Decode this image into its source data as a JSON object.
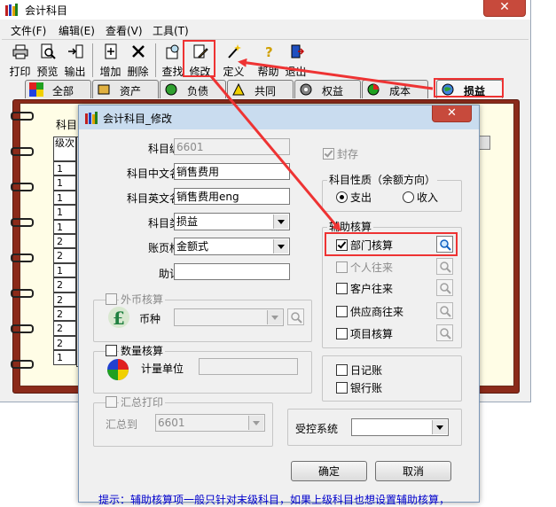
{
  "main_window": {
    "title": "会计科目",
    "close_glyph": "✕",
    "menu": [
      "文件(F)",
      "编辑(E)",
      "查看(V)",
      "工具(T)"
    ],
    "toolbar": [
      "打印",
      "预览",
      "输出",
      "增加",
      "删除",
      "查找",
      "修改",
      "定义",
      "帮助",
      "退出"
    ],
    "tabs": [
      "全部",
      "资产",
      "负债",
      "共同",
      "权益",
      "成本",
      "损益"
    ],
    "active_tab": "损益",
    "grid_label": "科目",
    "grid_header": "级次",
    "grid_levels": [
      "1",
      "1",
      "1",
      "1",
      "1",
      "2",
      "2",
      "1",
      "2",
      "2",
      "2",
      "2",
      "2",
      "1"
    ]
  },
  "dialog": {
    "title": "会计科目_修改",
    "close_glyph": "✕",
    "fields": {
      "code_label": "科目编码",
      "code_value": "6601",
      "cn_name_label": "科目中文名称",
      "cn_name_value": "销售费用",
      "en_name_label": "科目英文名称",
      "en_name_value": "销售费用eng",
      "type_label": "科目类型",
      "type_value": "损益",
      "format_label": "账页格式",
      "format_value": "金额式",
      "mnemonic_label": "助记码",
      "mnemonic_value": ""
    },
    "sealed_label": "封存",
    "foreign": {
      "title": "外币核算",
      "currency_label": "币种",
      "currency_value": ""
    },
    "quantity": {
      "title": "数量核算",
      "unit_label": "计量单位",
      "unit_value": ""
    },
    "summary": {
      "title": "汇总打印",
      "to_label": "汇总到",
      "to_value": "6601"
    },
    "nature": {
      "title": "科目性质（余额方向）",
      "debit": "支出",
      "credit": "收入",
      "selected": "支出"
    },
    "aux": {
      "title": "辅助核算",
      "items": [
        {
          "label": "部门核算",
          "checked": true,
          "enabled": true
        },
        {
          "label": "个人往来",
          "checked": false,
          "enabled": false
        },
        {
          "label": "客户往来",
          "checked": false,
          "enabled": true
        },
        {
          "label": "供应商往来",
          "checked": false,
          "enabled": true
        },
        {
          "label": "项目核算",
          "checked": false,
          "enabled": true
        }
      ]
    },
    "journal": {
      "daily_label": "日记账",
      "bank_label": "银行账"
    },
    "controlled": {
      "label": "受控系统",
      "value": ""
    },
    "ok_label": "确定",
    "cancel_label": "取消",
    "hint": "提示：辅助核算项一般只针对末级科目，如果上级科目也想设置辅助核算，"
  },
  "colors": {
    "annotation_red": "#ee3333",
    "hint_blue": "#0000cc",
    "notebook_brown": "#8b2a1a"
  }
}
